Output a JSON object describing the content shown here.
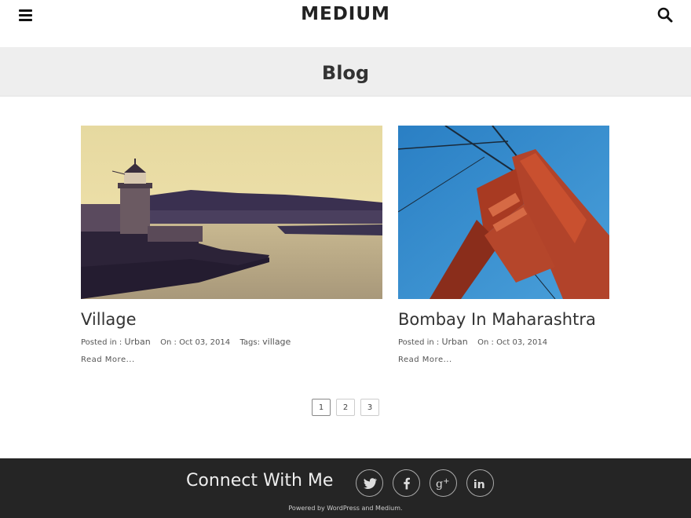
{
  "header": {
    "site_title": "MEDIUM",
    "menu_icon": "hamburger-menu-icon",
    "search_icon": "search-icon"
  },
  "banner": {
    "title": "Blog"
  },
  "posts": [
    {
      "title": "Village",
      "posted_in_label": "Posted in :",
      "category": "Urban",
      "on_label": "On :",
      "date": "Oct 03, 2014",
      "tags_label": "Tags:",
      "tag": "village",
      "read_more": "Read More..."
    },
    {
      "title": "Bombay In Maharashtra",
      "posted_in_label": "Posted in :",
      "category": "Urban",
      "on_label": "On :",
      "date": "Oct 03, 2014",
      "read_more": "Read More..."
    }
  ],
  "pagination": {
    "pages": [
      "1",
      "2",
      "3"
    ],
    "current": "1"
  },
  "footer": {
    "connect_title": "Connect With Me",
    "social_icons": [
      "twitter-icon",
      "facebook-icon",
      "google-plus-icon",
      "linkedin-icon"
    ],
    "powered_by": "Powered by WordPress and Medium."
  },
  "colors": {
    "footer_bg": "#252525",
    "banner_bg": "#eeeeee",
    "text": "#333333"
  }
}
